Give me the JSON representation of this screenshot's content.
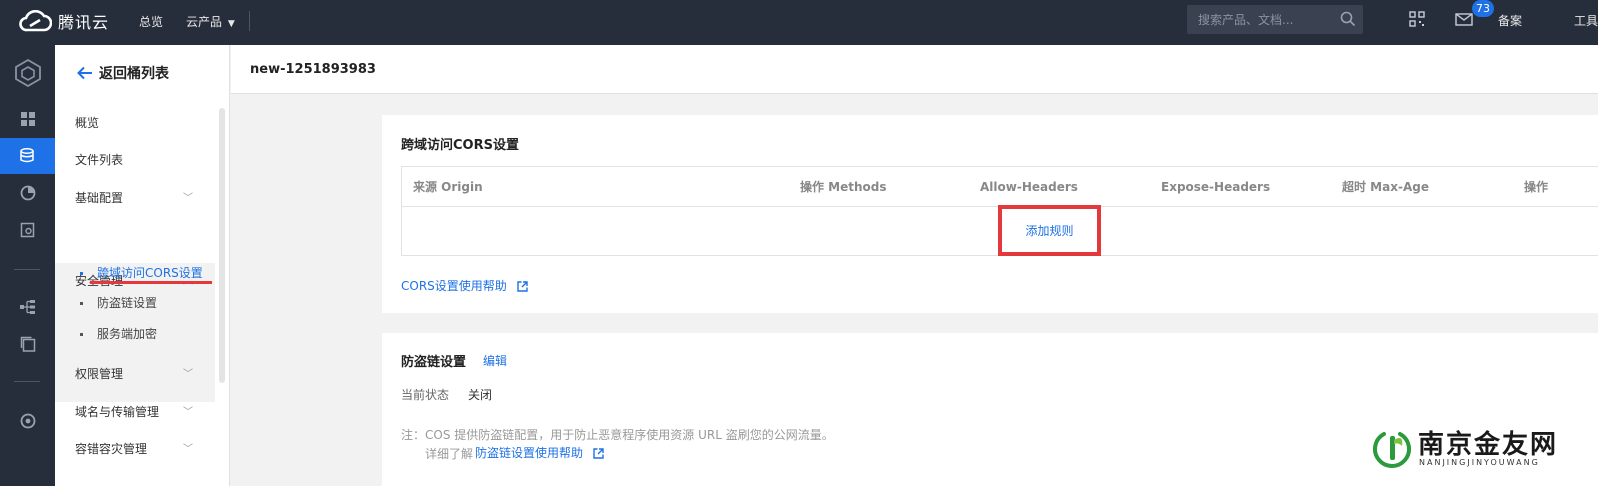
{
  "topbar": {
    "brand": "腾讯云",
    "nav_overview": "总览",
    "nav_products": "云产品",
    "search_placeholder": "搜索产品、文档...",
    "mail_badge": "73",
    "link_beian": "备案",
    "link_tools": "工具"
  },
  "sidebar": {
    "back_label": "返回桶列表",
    "items": [
      {
        "label": "概览"
      },
      {
        "label": "文件列表"
      },
      {
        "label": "基础配置"
      },
      {
        "label": "安全管理"
      },
      {
        "label": "权限管理"
      },
      {
        "label": "域名与传输管理"
      },
      {
        "label": "容错容灾管理"
      }
    ],
    "security_sub": [
      {
        "label": "跨域访问CORS设置"
      },
      {
        "label": "防盗链设置"
      },
      {
        "label": "服务端加密"
      }
    ]
  },
  "header": {
    "bucket_name": "new-1251893983"
  },
  "cors": {
    "title": "跨域访问CORS设置",
    "columns": [
      "来源 Origin",
      "操作 Methods",
      "Allow-Headers",
      "Expose-Headers",
      "超时 Max-Age",
      "操作"
    ],
    "add_rule": "添加规则",
    "help_link": "CORS设置使用帮助"
  },
  "hotlink": {
    "title": "防盗链设置",
    "edit": "编辑",
    "status_label": "当前状态",
    "status_value": "关闭",
    "note_line1": "注：COS 提供防盗链配置，用于防止恶意程序使用资源 URL 盗刷您的公网流量。",
    "note_prefix": "详细了解",
    "note_link": "防盗链设置使用帮助"
  },
  "watermark": {
    "name": "南京金友网",
    "pinyin": "NANJINGJINYOUWANG"
  }
}
